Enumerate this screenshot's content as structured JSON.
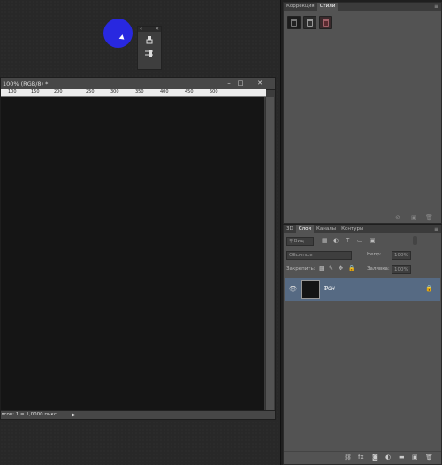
{
  "document": {
    "title": "100% (RGB/8) *",
    "ruler_ticks": [
      "100",
      "150",
      "200",
      "250",
      "300",
      "350",
      "400",
      "450",
      "500"
    ],
    "status_text": "лсов: 1 = 1,0000 пикс.",
    "window_buttons": {
      "minimize": "–",
      "maximize": "□",
      "close": "✕"
    }
  },
  "mini_tool": {
    "header_left": "«",
    "header_right": "✕",
    "icons": [
      "brush-preset-icon",
      "clone-source-icon"
    ]
  },
  "styles_panel": {
    "tabs": [
      "Коррекция",
      "Стили"
    ],
    "active_tab": "Стили",
    "swatches": [
      "#1c1c1c",
      "#2c2c2c",
      "#5a2b30"
    ]
  },
  "layers_panel": {
    "tabs": [
      "3D",
      "Слои",
      "Каналы",
      "Контуры"
    ],
    "active_tab": "Слои",
    "kind_filter": "Вид",
    "blend_mode": "Обычные",
    "opacity_label": "Непр:",
    "opacity_value": "100%",
    "lock_label": "Закрепить:",
    "fill_label": "Заливка:",
    "fill_value": "100%",
    "layer": {
      "name": "Фон"
    }
  },
  "colors": {
    "selection": "#566a83",
    "cursor_dot": "#2828e0"
  }
}
